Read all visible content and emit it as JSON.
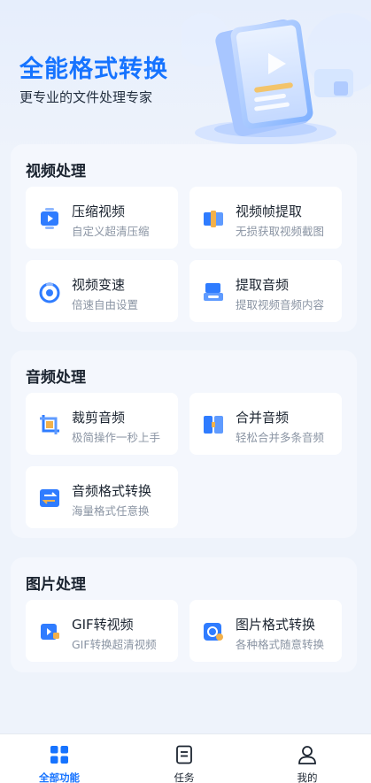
{
  "hero": {
    "title": "全能格式转换",
    "subtitle": "更专业的文件处理专家"
  },
  "sections": [
    {
      "title": "视频处理",
      "tiles": [
        {
          "icon": "video-compress-icon",
          "name": "压缩视频",
          "desc": "自定义超清压缩"
        },
        {
          "icon": "video-frame-icon",
          "name": "视频帧提取",
          "desc": "无损获取视频截图"
        },
        {
          "icon": "video-speed-icon",
          "name": "视频变速",
          "desc": "倍速自由设置"
        },
        {
          "icon": "extract-audio-icon",
          "name": "提取音频",
          "desc": "提取视频音频内容"
        }
      ]
    },
    {
      "title": "音频处理",
      "tiles": [
        {
          "icon": "audio-cut-icon",
          "name": "裁剪音频",
          "desc": "极简操作一秒上手"
        },
        {
          "icon": "audio-merge-icon",
          "name": "合并音频",
          "desc": "轻松合并多条音频"
        },
        {
          "icon": "audio-convert-icon",
          "name": "音频格式转换",
          "desc": "海量格式任意换"
        }
      ]
    },
    {
      "title": "图片处理",
      "tiles": [
        {
          "icon": "gif-video-icon",
          "name": "GIF转视频",
          "desc": "GIF转换超清视频"
        },
        {
          "icon": "image-convert-icon",
          "name": "图片格式转换",
          "desc": "各种格式随意转换"
        }
      ]
    }
  ],
  "tabbar": {
    "items": [
      {
        "icon": "grid-icon",
        "label": "全部功能",
        "active": true
      },
      {
        "icon": "task-icon",
        "label": "任务",
        "active": false
      },
      {
        "icon": "user-icon",
        "label": "我的",
        "active": false
      }
    ]
  },
  "colors": {
    "accent": "#1673ff",
    "background": "#eef3fb",
    "card": "#f4f7fd",
    "text": "#1b2430",
    "muted": "#8a94a3"
  }
}
